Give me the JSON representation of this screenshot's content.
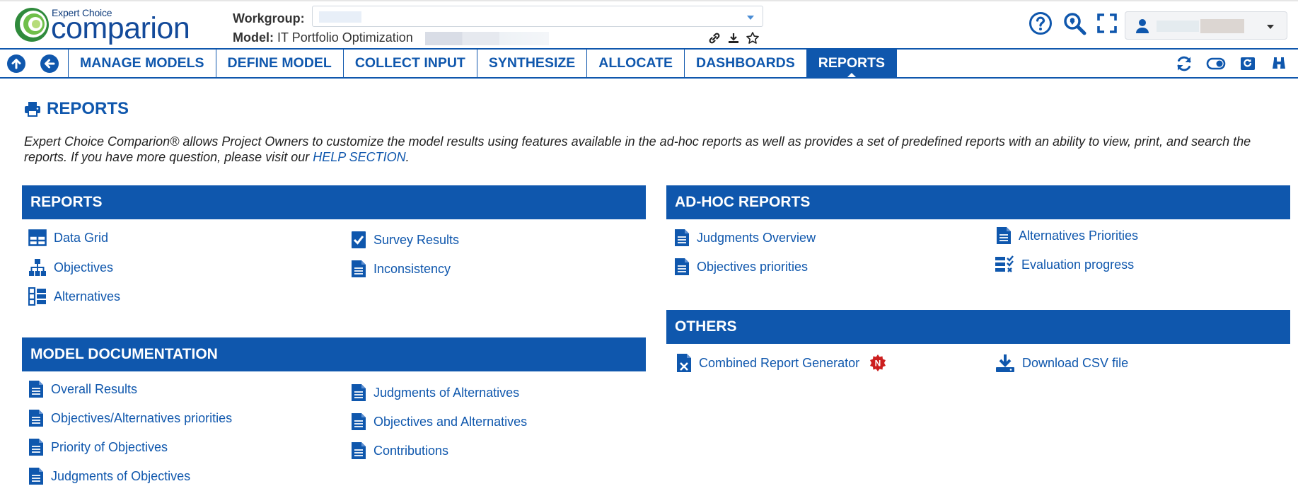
{
  "header": {
    "logo_small": "Expert Choice",
    "logo_big": "comparion",
    "workgroup_label": "Workgroup:",
    "model_label": "Model:",
    "model_name": "IT Portfolio Optimization"
  },
  "nav": {
    "tabs": [
      {
        "label": "MANAGE MODELS"
      },
      {
        "label": "DEFINE MODEL"
      },
      {
        "label": "COLLECT INPUT"
      },
      {
        "label": "SYNTHESIZE"
      },
      {
        "label": "ALLOCATE"
      },
      {
        "label": "DASHBOARDS"
      },
      {
        "label": "REPORTS",
        "active": true
      }
    ]
  },
  "page": {
    "title": "REPORTS",
    "intro": "Expert Choice Comparion® allows Project Owners to customize the model results using features available in the ad-hoc reports as well as provides a set of predefined reports with an ability to view, print, and search the reports. If you have more question, please visit our ",
    "help_link": "HELP SECTION",
    "intro_end": "."
  },
  "sections": {
    "reports": {
      "title": "REPORTS",
      "items": [
        "Data Grid",
        "Objectives",
        "Alternatives",
        "Survey Results",
        "Inconsistency"
      ]
    },
    "model_doc": {
      "title": "MODEL DOCUMENTATION",
      "items": [
        "Overall Results",
        "Objectives/Alternatives priorities",
        "Priority of Objectives",
        "Judgments of Objectives",
        "Judgments of Alternatives",
        "Objectives and Alternatives",
        "Contributions"
      ]
    },
    "adhoc": {
      "title": "AD-HOC REPORTS",
      "items": [
        "Judgments Overview",
        "Objectives priorities",
        "Alternatives Priorities",
        "Evaluation progress"
      ]
    },
    "others": {
      "title": "OTHERS",
      "items": [
        "Combined Report Generator",
        "Download CSV file"
      ],
      "new_badge": "N"
    }
  },
  "colors": {
    "brand_blue": "#0f57ad",
    "new_badge": "#cc1f1f"
  }
}
